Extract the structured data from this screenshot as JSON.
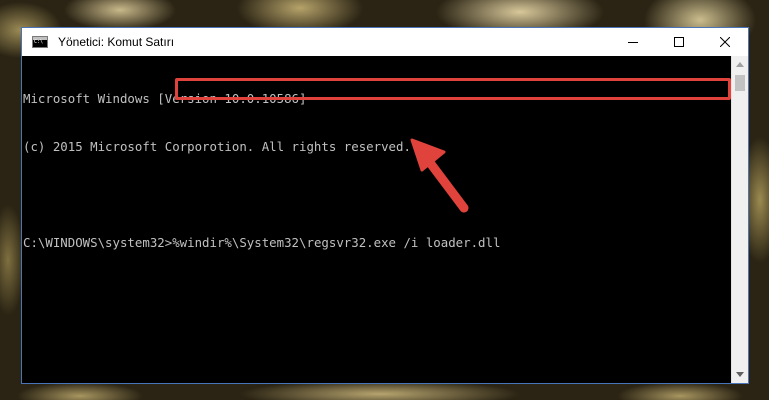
{
  "window": {
    "title": "Yönetici: Komut Satırı",
    "controls": {
      "minimize_icon": "minimize-icon",
      "maximize_icon": "maximize-icon",
      "close_icon": "close-icon"
    }
  },
  "console": {
    "lines": [
      "Microsoft Windows [Version 10.0.10586]",
      "(c) 2015 Microsoft Corporotion. All rights reserved.",
      ""
    ],
    "prompt": "C:\\WINDOWS\\system32>",
    "command": "%windir%\\System32\\regsvr32.exe /i loader.dll"
  },
  "colors": {
    "console_background": "#000000",
    "console_text": "#c0c0c0",
    "highlight": "#e0433c",
    "window_border": "#4a74b8"
  },
  "annotations": {
    "arrow_icon": "red-arrow-icon"
  }
}
